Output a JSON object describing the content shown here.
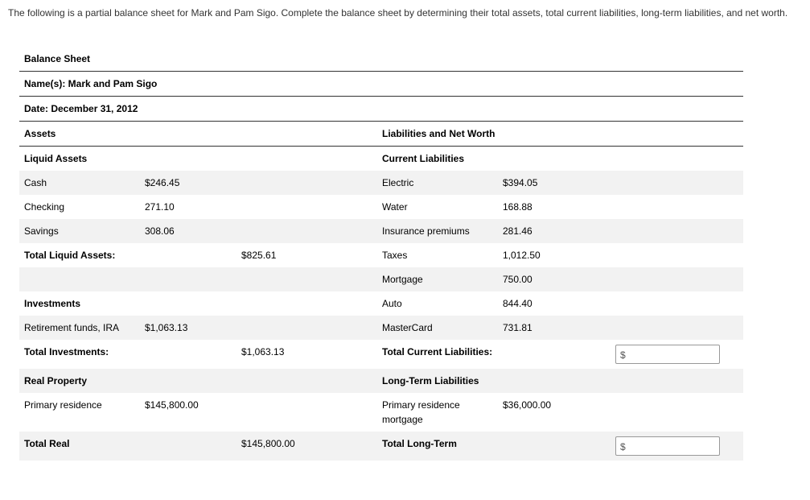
{
  "instructions": "The following is a partial balance sheet for Mark and Pam Sigo. Complete the balance sheet by determining their total assets, total current liabilities, long-term liabilities, and net worth.",
  "sheet": {
    "title": "Balance Sheet",
    "names_label": "Name(s): Mark and Pam Sigo",
    "date_label": "Date: December 31, 2012",
    "assets_header": "Assets",
    "liab_header": "Liabilities and Net Worth",
    "liquid_header": "Liquid Assets",
    "curliab_header": "Current Liabilities",
    "cash_label": "Cash",
    "cash_val": "$246.45",
    "electric_label": "Electric",
    "electric_val": "$394.05",
    "checking_label": "Checking",
    "checking_val": "271.10",
    "water_label": "Water",
    "water_val": "168.88",
    "savings_label": "Savings",
    "savings_val": "308.06",
    "insurance_label": "Insurance premiums",
    "insurance_val": "281.46",
    "total_liquid_label": "Total Liquid Assets:",
    "total_liquid_val": "$825.61",
    "taxes_label": "Taxes",
    "taxes_val": "1,012.50",
    "mortgage_label": "Mortgage",
    "mortgage_val": "750.00",
    "investments_header": "Investments",
    "auto_label": "Auto",
    "auto_val": "844.40",
    "retire_label": "Retirement funds, IRA",
    "retire_val": "$1,063.13",
    "mc_label": "MasterCard",
    "mc_val": "731.81",
    "total_inv_label": "Total Investments:",
    "total_inv_val": "$1,063.13",
    "total_curliab_label": "Total Current Liabilities:",
    "realprop_header": "Real Property",
    "longterm_header": "Long-Term Liabilities",
    "primres_label": "Primary residence",
    "primres_val": "$145,800.00",
    "primres_mort_label": "Primary residence mortgage",
    "primres_mort_val": "$36,000.00",
    "total_real_label": "Total Real",
    "total_real_val": "$145,800.00",
    "total_longterm_label": "Total Long-Term"
  },
  "dollar_sign": "$"
}
